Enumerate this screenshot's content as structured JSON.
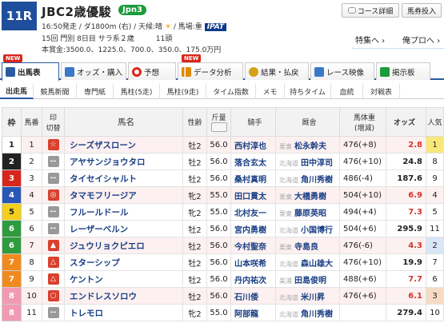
{
  "race": {
    "number": "11R",
    "name": "JBC2歳優駿",
    "grade": "Jpn3",
    "info_line1": "16:50発走 / ダ1800m (右) / 天候:晴",
    "weather_icon": "☀",
    "track_condition": "/ 馬場:重",
    "ipat": "IPAT",
    "info_line2": "15回 門別 8日目 サラ系２歳　　　11頭",
    "info_line3": "本賞金:3500.0、1225.0、700.0、350.0、175.0万円"
  },
  "header_buttons": {
    "course": "コース詳細",
    "lead": "馬券投入"
  },
  "header_links": {
    "feature": "特集へ ›",
    "pro": "俺プロへ ›"
  },
  "tabs": [
    {
      "label": "出馬表",
      "icon": "table-icon",
      "color": "#2c5aa0",
      "new": true
    },
    {
      "label": "オッズ・購入",
      "icon": "odds-icon",
      "color": "#3b79c8",
      "new": false
    },
    {
      "label": "予想",
      "icon": "target-icon",
      "color": "#d9261c",
      "new": false
    },
    {
      "label": "データ分析",
      "icon": "chart-icon",
      "color": "#e08a00",
      "new": true
    },
    {
      "label": "結果・払戻",
      "icon": "coins-icon",
      "color": "#d4a017",
      "new": false
    },
    {
      "label": "レース映像",
      "icon": "video-icon",
      "color": "#3b79c8",
      "new": false
    },
    {
      "label": "掲示板",
      "icon": "board-icon",
      "color": "#1a9b3c",
      "new": false
    }
  ],
  "new_label": "NEW",
  "subtabs": [
    "出走馬",
    "競馬新聞",
    "専門紙",
    "馬柱(5走)",
    "馬柱(9走)",
    "タイム指数",
    "メモ",
    "持ちタイム",
    "血統",
    "対戦表"
  ],
  "table": {
    "headers": {
      "waku": "枠",
      "uma": "馬番",
      "mark": "印",
      "mark_sub": "切替",
      "name": "馬名",
      "sex": "性齢",
      "kin": "斤量",
      "jockey": "騎手",
      "trainer": "厩舎",
      "weight": "馬体重",
      "weight_sub": "(増減)",
      "odds": "オッズ",
      "pop": "人気"
    },
    "rows": [
      {
        "waku": "1",
        "uma": "1",
        "mark": "☆",
        "name": "シーズザスローン",
        "sex": "牡2",
        "kin": "56.0",
        "jockey": "西村淳也",
        "region": "栗東",
        "trainer": "松永幹夫",
        "weight": "476(+8)",
        "odds": "2.8",
        "pop": "1"
      },
      {
        "waku": "2",
        "uma": "2",
        "mark": "--",
        "name": "アヤサンジョウタロ",
        "sex": "牡2",
        "kin": "56.0",
        "jockey": "落合玄太",
        "region": "北海道",
        "trainer": "田中淳司",
        "weight": "476(+10)",
        "odds": "24.8",
        "pop": "8"
      },
      {
        "waku": "3",
        "uma": "3",
        "mark": "--",
        "name": "タイセイシャルト",
        "sex": "牡2",
        "kin": "56.0",
        "jockey": "桑村真明",
        "region": "北海道",
        "trainer": "角川秀樹",
        "weight": "486(-4)",
        "odds": "187.6",
        "pop": "9"
      },
      {
        "waku": "4",
        "uma": "4",
        "mark": "◎",
        "name": "タマモフリージア",
        "sex": "牝2",
        "kin": "55.0",
        "jockey": "田口貫太",
        "region": "栗東",
        "trainer": "大橋勇樹",
        "weight": "504(+10)",
        "odds": "6.9",
        "pop": "4"
      },
      {
        "waku": "5",
        "uma": "5",
        "mark": "--",
        "name": "フルールドール",
        "sex": "牝2",
        "kin": "55.0",
        "jockey": "北村友一",
        "region": "栗東",
        "trainer": "藤原英昭",
        "weight": "494(+4)",
        "odds": "7.3",
        "pop": "5"
      },
      {
        "waku": "6",
        "uma": "6",
        "mark": "--",
        "name": "レーザーベルン",
        "sex": "牡2",
        "kin": "56.0",
        "jockey": "宮内勇樹",
        "region": "北海道",
        "trainer": "小国博行",
        "weight": "504(+6)",
        "odds": "295.9",
        "pop": "11"
      },
      {
        "waku": "6",
        "uma": "7",
        "mark": "▲",
        "name": "ジュウリョクピエロ",
        "sex": "牡2",
        "kin": "56.0",
        "jockey": "今村聖奈",
        "region": "栗東",
        "trainer": "寺島良",
        "weight": "476(-6)",
        "odds": "4.3",
        "pop": "2"
      },
      {
        "waku": "7",
        "uma": "8",
        "mark": "△",
        "name": "スターシップ",
        "sex": "牡2",
        "kin": "56.0",
        "jockey": "山本咲希",
        "region": "北海道",
        "trainer": "森山雄大",
        "weight": "476(+10)",
        "odds": "19.9",
        "pop": "7"
      },
      {
        "waku": "7",
        "uma": "9",
        "mark": "△",
        "name": "ケントン",
        "sex": "牡2",
        "kin": "56.0",
        "jockey": "丹内祐次",
        "region": "美浦",
        "trainer": "田島俊明",
        "weight": "488(+6)",
        "odds": "7.7",
        "pop": "6"
      },
      {
        "waku": "8",
        "uma": "10",
        "mark": "○",
        "name": "エンドレスソロウ",
        "sex": "牡2",
        "kin": "56.0",
        "jockey": "石川倭",
        "region": "北海道",
        "trainer": "米川昇",
        "weight": "476(+6)",
        "odds": "6.1",
        "pop": "3"
      },
      {
        "waku": "8",
        "uma": "11",
        "mark": "--",
        "name": "トレモロ",
        "sex": "牝2",
        "kin": "55.0",
        "jockey": "阿部龍",
        "region": "北海道",
        "trainer": "角川秀樹",
        "weight": "",
        "odds": "279.4",
        "pop": "10"
      }
    ]
  },
  "colors": {
    "waku": {
      "1": "#ffffff",
      "2": "#222222",
      "3": "#d9261c",
      "4": "#2857b8",
      "5": "#f2cf1d",
      "6": "#2f9b3f",
      "7": "#f18a1e",
      "8": "#f29ab5"
    },
    "accent": "#2c5aa0",
    "grade": "#1a9b3c"
  }
}
